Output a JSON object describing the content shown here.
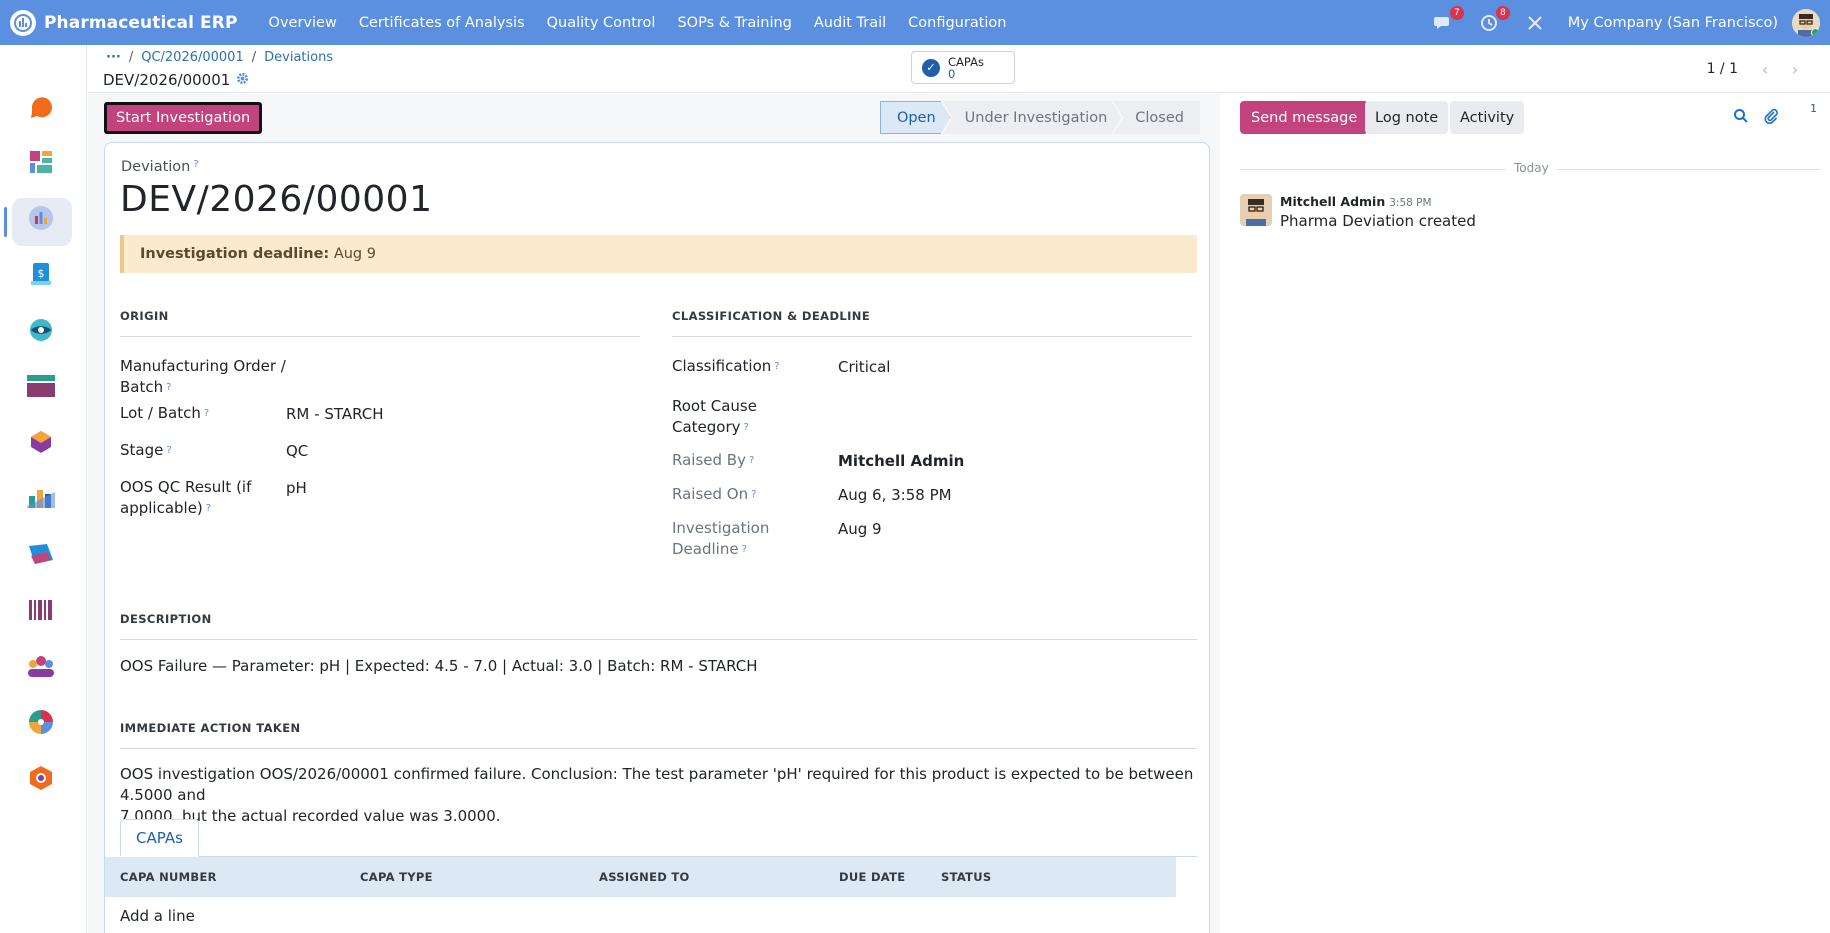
{
  "topbar": {
    "brand": "Pharmaceutical ERP",
    "menu": [
      "Overview",
      "Certificates of Analysis",
      "Quality Control",
      "SOPs & Training",
      "Audit Trail",
      "Configuration"
    ],
    "messages_badge": "7",
    "activities_badge": "8",
    "company": "My Company (San Francisco)"
  },
  "breadcrumb": {
    "ellipsis": "···",
    "crumbs": [
      "QC/2026/00001",
      "Deviations"
    ],
    "record": "DEV/2026/00001"
  },
  "stat_button": {
    "label": "CAPAs",
    "count": "0"
  },
  "pager": {
    "value": "1 / 1"
  },
  "actions": {
    "primary": "Start Investigation"
  },
  "statusbar": [
    "Open",
    "Under Investigation",
    "Closed"
  ],
  "form": {
    "label": "Deviation",
    "title": "DEV/2026/00001",
    "alert_label": "Investigation deadline:",
    "alert_value": "Aug 9",
    "origin": {
      "heading": "ORIGIN",
      "mo_label_1": "Manufacturing Order /",
      "mo_label_2": "Batch",
      "lot_label": "Lot / Batch",
      "lot_value": "RM - STARCH",
      "stage_label": "Stage",
      "stage_value": "QC",
      "oos_label_1": "OOS QC Result (if",
      "oos_label_2": "applicable)",
      "oos_value": "pH"
    },
    "classification": {
      "heading": "CLASSIFICATION & DEADLINE",
      "class_label": "Classification",
      "class_value": "Critical",
      "root_label_1": "Root Cause",
      "root_label_2": "Category",
      "raised_by_label": "Raised By",
      "raised_by_value": "Mitchell Admin",
      "raised_on_label": "Raised On",
      "raised_on_value": "Aug 6, 3:58 PM",
      "deadline_label_1": "Investigation",
      "deadline_label_2": "Deadline",
      "deadline_value": "Aug 9"
    },
    "description": {
      "heading": "DESCRIPTION",
      "text": "OOS Failure — Parameter: pH | Expected: 4.5 - 7.0 | Actual: 3.0 | Batch: RM - STARCH"
    },
    "immediate_action": {
      "heading": "IMMEDIATE ACTION TAKEN",
      "line1": "OOS investigation OOS/2026/00001 confirmed failure. Conclusion: The test parameter 'pH' required for this product is expected to be between 4.5000 and",
      "line2": "7.0000, but the actual recorded value was 3.0000."
    },
    "notebook": {
      "tab": "CAPAs",
      "columns": [
        "CAPA NUMBER",
        "CAPA TYPE",
        "ASSIGNED TO",
        "DUE DATE",
        "STATUS"
      ],
      "add_line": "Add a line"
    }
  },
  "chatter": {
    "send_message": "Send message",
    "log_note": "Log note",
    "activity": "Activity",
    "followers": "1",
    "date_separator": "Today",
    "message": {
      "author": "Mitchell Admin",
      "time": "3:58 PM",
      "body": "Pharma Deviation created"
    }
  },
  "colors": {
    "navbar": "#5b8fe0",
    "primary": "#c2437d",
    "link": "#1f5fa8",
    "alert_bg": "#fbebcd"
  }
}
